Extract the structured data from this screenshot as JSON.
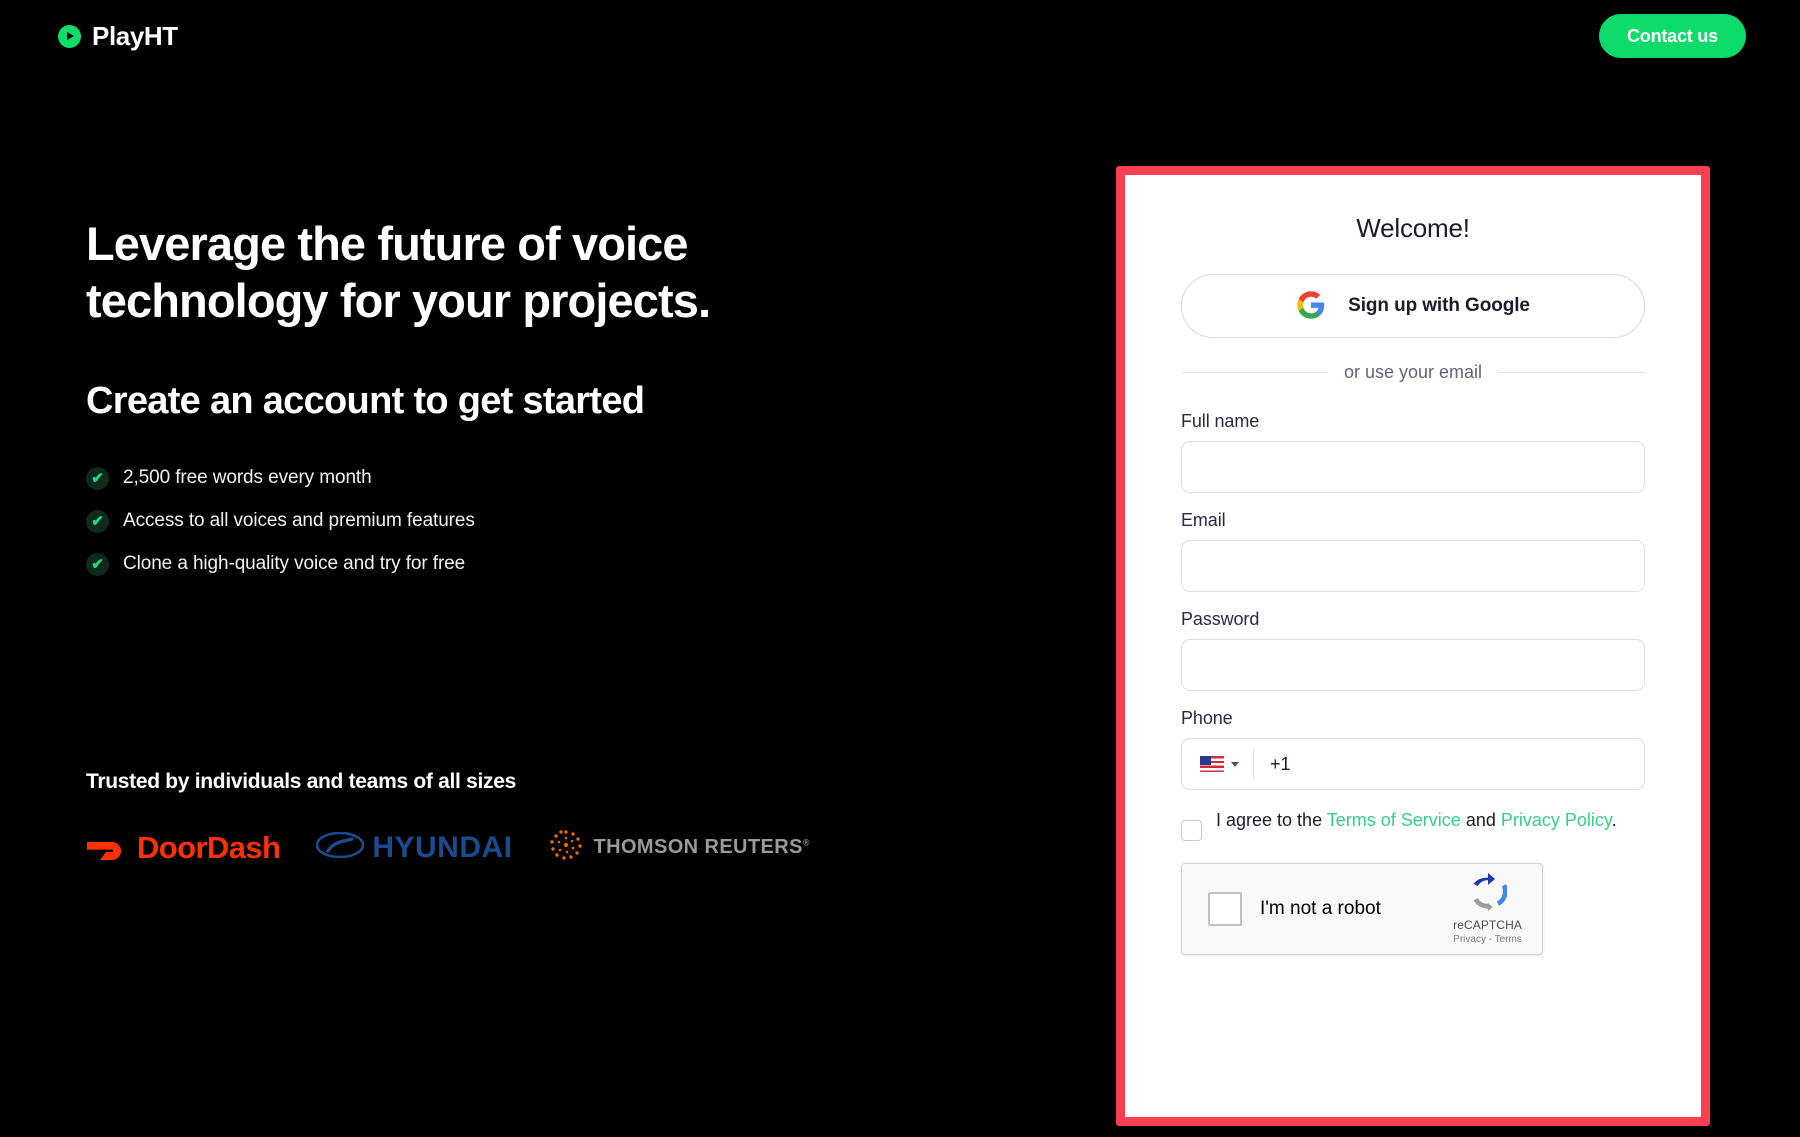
{
  "header": {
    "brand_name": "PlayHT",
    "brand_icon": "play-circle-icon",
    "contact_label": "Contact us",
    "accent_green": "#0ddc6a"
  },
  "hero": {
    "headline": "Leverage the future of voice technology for your projects.",
    "subhead": "Create an account to get started",
    "benefits": [
      {
        "icon": "check-icon",
        "text": "2,500 free words every month"
      },
      {
        "icon": "check-icon",
        "text": "Access to all voices and premium features"
      },
      {
        "icon": "check-icon",
        "text": "Clone a high-quality voice and try for free"
      }
    ]
  },
  "trusted": {
    "title": "Trusted by individuals and teams of all sizes",
    "logos": [
      {
        "name": "DoorDash",
        "color": "#ff3008"
      },
      {
        "name": "HYUNDAI",
        "color": "#1b4b8f"
      },
      {
        "name": "THOMSON REUTERS",
        "color": "#9a9a9a"
      }
    ]
  },
  "signup": {
    "border_color": "#fa4050",
    "title": "Welcome!",
    "google_button": {
      "label": "Sign up with Google",
      "icon": "google-g-icon"
    },
    "divider_label": "or use your email",
    "fields": [
      {
        "label": "Full name",
        "value": "",
        "placeholder": "",
        "type": "text"
      },
      {
        "label": "Email",
        "value": "",
        "placeholder": "",
        "type": "email"
      },
      {
        "label": "Password",
        "value": "",
        "placeholder": "",
        "type": "password"
      }
    ],
    "phone": {
      "label": "Phone",
      "country_flag": "us-flag-icon",
      "dial_code": "+1",
      "value": ""
    },
    "terms": {
      "checked": false,
      "prefix": "I agree to the ",
      "link1": "Terms of Service",
      "middle": " and ",
      "link2": "Privacy Policy",
      "suffix": ".",
      "link_color": "#36cf87"
    },
    "recaptcha": {
      "label": "I'm not a robot",
      "brand": "reCAPTCHA",
      "legal": "Privacy - Terms",
      "checked": false
    }
  }
}
